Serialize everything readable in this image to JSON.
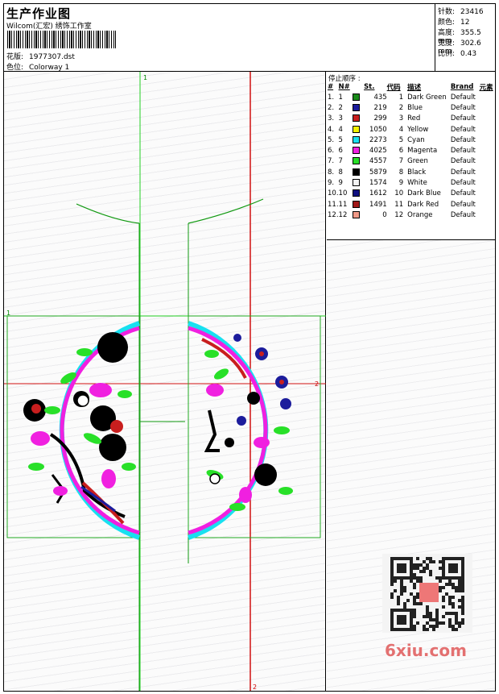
{
  "header": {
    "title": "生产作业图",
    "company": "Wilcom(汇宏) 绣饰工作室",
    "design_label": "花版:",
    "design_value": "1977307.dst",
    "colorway_label": "色位:",
    "colorway_value": "Colorway 1"
  },
  "stats": {
    "stitches_label": "针数:",
    "stitches_value": "23416",
    "colors_label": "颜色:",
    "colors_value": "12",
    "height_label": "高度:",
    "height_value": "355.5 mm",
    "width_label": "宽度:",
    "width_value": "302.6 mm",
    "scale_label": "比例:",
    "scale_value": "0.43"
  },
  "stop_sequence": {
    "title": "停止顺序 :",
    "columns": [
      "#",
      "N#",
      "St.",
      "代码",
      "描述",
      "Brand",
      "元素"
    ],
    "rows": [
      {
        "idx": "1.",
        "no": "1",
        "color": "#1a8a1a",
        "st": "435",
        "code": "1",
        "desc": "Dark Green",
        "brand": "Default"
      },
      {
        "idx": "2.",
        "no": "2",
        "color": "#1c1c9c",
        "st": "219",
        "code": "2",
        "desc": "Blue",
        "brand": "Default"
      },
      {
        "idx": "3.",
        "no": "3",
        "color": "#c81e1e",
        "st": "299",
        "code": "3",
        "desc": "Red",
        "brand": "Default"
      },
      {
        "idx": "4.",
        "no": "4",
        "color": "#f2f200",
        "st": "1050",
        "code": "4",
        "desc": "Yellow",
        "brand": "Default"
      },
      {
        "idx": "5.",
        "no": "5",
        "color": "#18e0f0",
        "st": "2273",
        "code": "5",
        "desc": "Cyan",
        "brand": "Default"
      },
      {
        "idx": "6.",
        "no": "6",
        "color": "#f020e0",
        "st": "4025",
        "code": "6",
        "desc": "Magenta",
        "brand": "Default"
      },
      {
        "idx": "7.",
        "no": "7",
        "color": "#28e028",
        "st": "4557",
        "code": "7",
        "desc": "Green",
        "brand": "Default"
      },
      {
        "idx": "8.",
        "no": "8",
        "color": "#000000",
        "st": "5879",
        "code": "8",
        "desc": "Black",
        "brand": "Default"
      },
      {
        "idx": "9.",
        "no": "9",
        "color": "#f4f4f4",
        "st": "1574",
        "code": "9",
        "desc": "White",
        "brand": "Default"
      },
      {
        "idx": "10.",
        "no": "10",
        "color": "#101080",
        "st": "1612",
        "code": "10",
        "desc": "Dark Blue",
        "brand": "Default"
      },
      {
        "idx": "11.",
        "no": "11",
        "color": "#a01818",
        "st": "1491",
        "code": "11",
        "desc": "Dark Red",
        "brand": "Default"
      },
      {
        "idx": "12.",
        "no": "12",
        "color": "#f09a88",
        "st": "0",
        "code": "12",
        "desc": "Orange",
        "brand": "Default"
      }
    ]
  },
  "canvas": {
    "guide_top_label": "1",
    "guide_left_label": "1",
    "guide_bottom_label": "2",
    "guide_right_label": "2"
  },
  "watermark": "6xiu.com"
}
